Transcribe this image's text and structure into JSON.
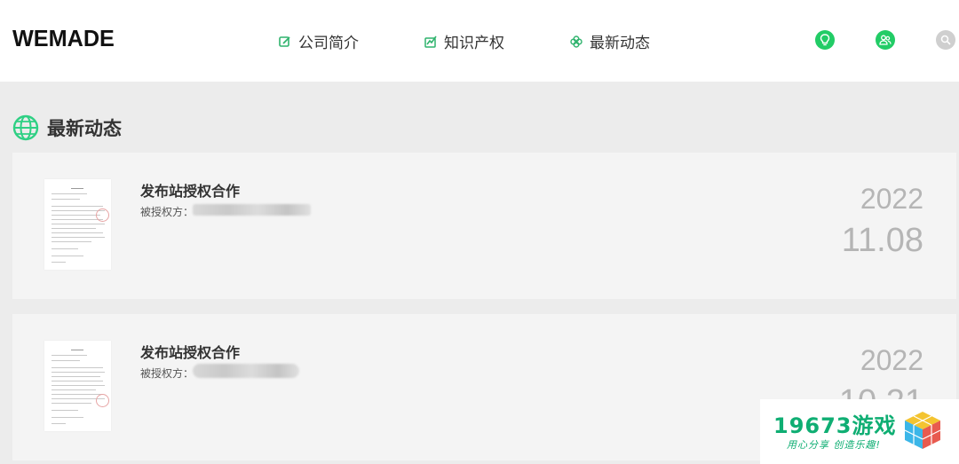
{
  "header": {
    "logo": "WEMADE",
    "nav": [
      {
        "label": "公司简介",
        "icon": "edit-icon"
      },
      {
        "label": "知识产权",
        "icon": "signature-icon"
      },
      {
        "label": "最新动态",
        "icon": "clover-icon"
      }
    ],
    "icons": [
      {
        "name": "lightbulb-icon",
        "color": "#22cc66"
      },
      {
        "name": "users-icon",
        "color": "#22cc66"
      },
      {
        "name": "search-icon",
        "color": "#cccccc"
      }
    ]
  },
  "section": {
    "title": "最新动态",
    "icon": "globe-icon",
    "icon_color": "#2fd084"
  },
  "news": [
    {
      "title": "发布站授权合作",
      "label": "被授权方：",
      "year": "2022",
      "date": "11.08"
    },
    {
      "title": "发布站授权合作",
      "label": "被授权方：",
      "year": "2022",
      "date": "10.21"
    }
  ],
  "watermark": {
    "main": "19673游戏",
    "tagline": "用心分享 创造乐趣!"
  },
  "colors": {
    "accent": "#22cc66",
    "page_bg": "#ececec",
    "card_bg": "#f4f4f4",
    "date_text": "#b5b5b5"
  }
}
